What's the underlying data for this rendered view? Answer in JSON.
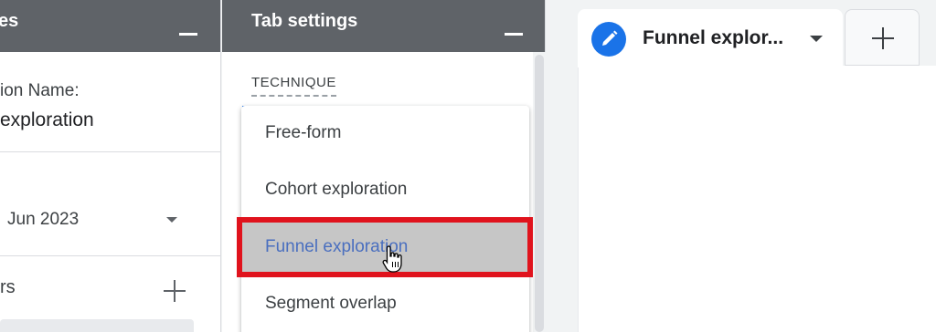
{
  "variables_panel": {
    "title": "es",
    "exploration_name_label": "ion Name:",
    "exploration_name_value": " exploration",
    "date_range_value": "Jun 2023",
    "segments_label": "rs"
  },
  "tab_settings": {
    "title": "Tab settings",
    "technique_label": "TECHNIQUE",
    "technique_options": [
      {
        "label": "Free-form"
      },
      {
        "label": "Cohort exploration"
      },
      {
        "label": "Funnel exploration"
      },
      {
        "label": "Segment overlap"
      }
    ],
    "selected_option": "Funnel exploration"
  },
  "canvas": {
    "active_tab_label": "Funnel explor...",
    "active_tab_icon": "pencil-icon"
  },
  "colors": {
    "header_bg": "#5f6368",
    "accent_blue": "#1a73e8",
    "highlight_red": "#e0131d",
    "selected_bg": "#c6c6c6",
    "selected_text": "#4a6fbf"
  }
}
